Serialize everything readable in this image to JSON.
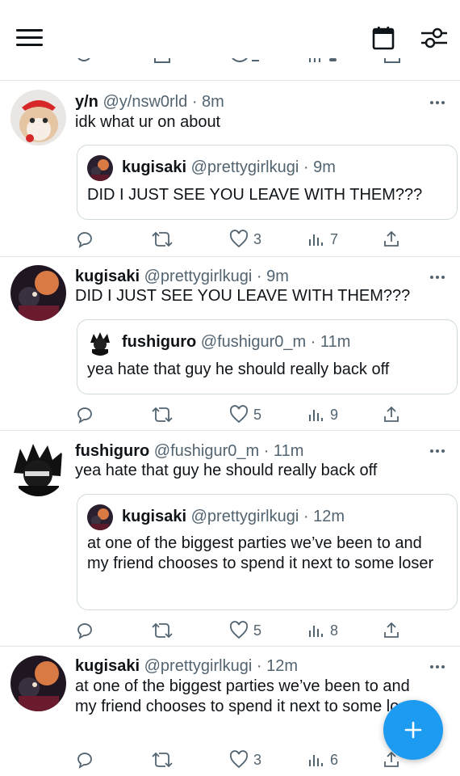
{
  "colors": {
    "accent": "#1d9bf0",
    "text": "#0f1419",
    "muted": "#536471",
    "divider": "#e1e5e8"
  },
  "header": {
    "menu_icon": "menu-icon",
    "calendar_icon": "calendar-icon",
    "filter_icon": "sliders-icon"
  },
  "tweets": [
    {
      "name": "y/n",
      "handle": "@y/nsw0rld",
      "time": "· 8m",
      "text": "idk what ur on about",
      "quote": {
        "name": "kugisaki",
        "handle": "@prettygirlkugi",
        "time": "· 9m",
        "text": "DID I JUST SEE YOU LEAVE WITH THEM???"
      },
      "likes": "3",
      "views": "7"
    },
    {
      "name": "kugisaki",
      "handle": "@prettygirlkugi",
      "time": "· 9m",
      "text": "DID I JUST SEE YOU LEAVE WITH THEM???",
      "quote": {
        "name": "fushiguro",
        "handle": "@fushigur0_m",
        "time": "· 11m",
        "text": "yea hate that guy he should really back off"
      },
      "likes": "5",
      "views": "9"
    },
    {
      "name": "fushiguro",
      "handle": "@fushigur0_m",
      "time": "· 11m",
      "text": "yea hate that guy he should really back off",
      "quote": {
        "name": "kugisaki",
        "handle": "@prettygirlkugi",
        "time": "· 12m",
        "text": "at one of the biggest parties we’ve been to and my friend chooses to spend it next to some loser"
      },
      "likes": "5",
      "views": "8"
    },
    {
      "name": "kugisaki",
      "handle": "@prettygirlkugi",
      "time": "· 12m",
      "text": "at one of the biggest parties we’ve been to and my friend chooses to spend it next to some loser",
      "likes": "3",
      "views": "6"
    }
  ],
  "fab": {
    "icon": "plus-icon"
  }
}
